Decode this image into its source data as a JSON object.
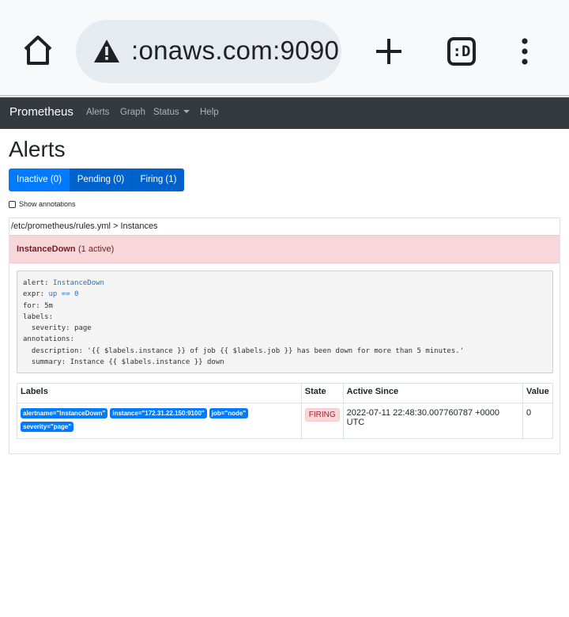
{
  "browser": {
    "url": ":onaws.com:9090",
    "tabs_label": ":D",
    "icons": {
      "home": "home-icon",
      "warning": "warning-icon",
      "new_tab": "plus-icon",
      "menu": "more-vert-icon"
    }
  },
  "navbar": {
    "brand": "Prometheus",
    "links": {
      "alerts": "Alerts",
      "graph": "Graph",
      "status": "Status",
      "help": "Help"
    }
  },
  "page": {
    "title": "Alerts",
    "filters": {
      "inactive": "Inactive (0)",
      "pending": "Pending (0)",
      "firing": "Firing (1)"
    },
    "show_annotations": "Show annotations"
  },
  "rule_group": {
    "path": "/etc/prometheus/rules.yml > Instances",
    "alert_name": "InstanceDown",
    "active_count": "(1 active)",
    "definition": {
      "alert_key": "alert: ",
      "alert_value": "InstanceDown",
      "expr_key": "expr: ",
      "expr_value": "up == 0",
      "for_line": "for: 5m",
      "labels_line": "labels:",
      "severity_line": "  severity: page",
      "annotations_line": "annotations:",
      "description_line": "  description: '{{ $labels.instance }} of job {{ $labels.job }} has been down for more than 5 minutes.'",
      "summary_line": "  summary: Instance {{ $labels.instance }} down"
    },
    "table": {
      "headers": {
        "labels": "Labels",
        "state": "State",
        "active_since": "Active Since",
        "value": "Value"
      },
      "row": {
        "labels": {
          "alertname": "alertname=\"InstanceDown\"",
          "instance": "instance=\"172.31.22.150:9100\"",
          "job": "job=\"node\"",
          "severity": "severity=\"page\""
        },
        "state": "FIRING",
        "active_since": "2022-07-11 22:48:30.007760787 +0000 UTC",
        "value": "0"
      }
    }
  },
  "colors": {
    "navbar": "#343a40",
    "primary": "#007bff",
    "alert_bg": "#f8d7da",
    "alert_text": "#721c24"
  }
}
